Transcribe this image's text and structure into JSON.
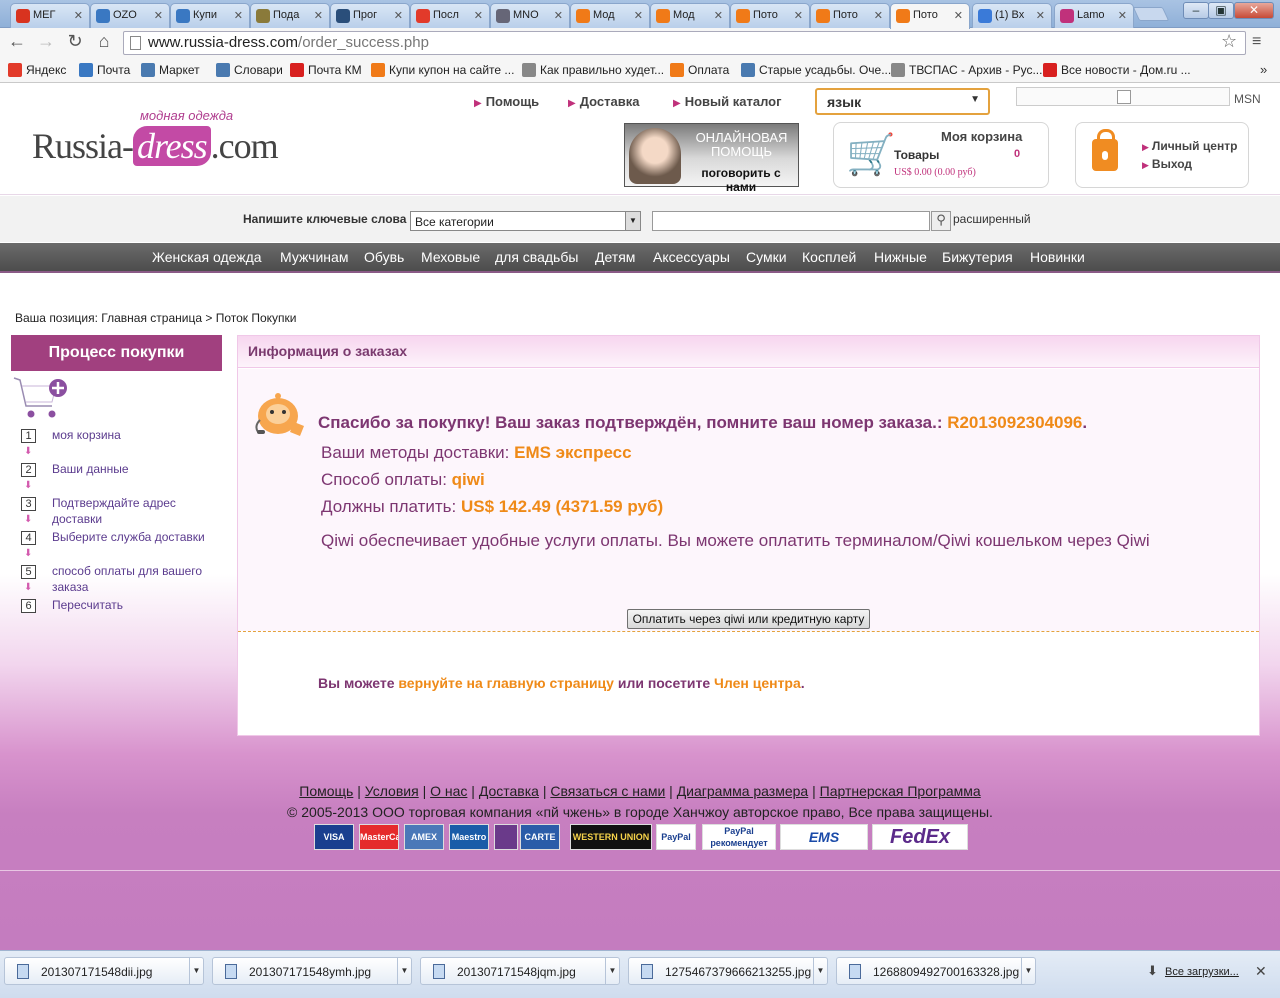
{
  "browser": {
    "tabs": [
      {
        "label": "МЕГ",
        "color": "#d8331f"
      },
      {
        "label": "OZO",
        "color": "#3a78c2"
      },
      {
        "label": "Купи",
        "color": "#3a78c2"
      },
      {
        "label": "Пода",
        "color": "#8a7a3a"
      },
      {
        "label": "Прог",
        "color": "#2a4e7a"
      },
      {
        "label": "Посл",
        "color": "#e23a2a"
      },
      {
        "label": "MNO",
        "color": "#667"
      },
      {
        "label": "Мод",
        "color": "#f07a18"
      },
      {
        "label": "Мод",
        "color": "#f07a18"
      },
      {
        "label": "Пото",
        "color": "#f07a18"
      },
      {
        "label": "Пото",
        "color": "#f07a18"
      },
      {
        "label": "Пото",
        "color": "#f07a18"
      },
      {
        "label": "(1) Вх",
        "color": "#3a7ad8"
      },
      {
        "label": "Lamo",
        "color": "#c0317b"
      }
    ],
    "active_tab": 11,
    "url_host": "www.russia-dress.com",
    "url_path": "/order_success.php",
    "bookmarks": [
      {
        "label": "Яндекс",
        "color": "#e23a2a"
      },
      {
        "label": "Почта",
        "color": "#3a78c2"
      },
      {
        "label": "Маркет",
        "color": "#4a7ab0"
      },
      {
        "label": "Словари",
        "color": "#4a7ab0"
      },
      {
        "label": "Почта КМ",
        "color": "#d8201f"
      },
      {
        "label": "Купи купон на сайте ...",
        "color": "#f07a18"
      },
      {
        "label": "Как правильно худет...",
        "color": "#888"
      },
      {
        "label": "Оплата",
        "color": "#f07a18"
      },
      {
        "label": "Старые усадьбы. Оче...",
        "color": "#4a7ab0"
      },
      {
        "label": "ТВСПАС - Архив - Рус...",
        "color": "#888"
      },
      {
        "label": "Все новости - Дом.ru ...",
        "color": "#d8201f"
      }
    ]
  },
  "header": {
    "logo_tag": "модная одежда",
    "logo_left": "Russia-",
    "logo_dress": "dress",
    "logo_right": ".com",
    "top_links": [
      "Помощь",
      "Доставка",
      "Новый каталог"
    ],
    "language_label": "язык",
    "msn_label": "MSN",
    "help_banner_line1": "ОНЛАЙНОВАЯ ПОМОЩЬ",
    "help_banner_line2": "поговорить с нами",
    "cart_title": "Моя корзина",
    "cart_goods_label": "Товары",
    "cart_goods_count": "0",
    "cart_sum": "US$ 0.00 (0.00 руб)",
    "account_links": [
      "Личный центр",
      "Выход"
    ]
  },
  "search": {
    "label": "Напишите ключевые слова",
    "category_value": "Все категории",
    "advanced_label": "расширенный"
  },
  "mainnav": [
    "Женская одежда",
    "Мужчинам",
    "Обувь",
    "Меховые",
    "для свадьбы",
    "Детям",
    "Аксессуары",
    "Сумки",
    "Косплей",
    "Нижные",
    "Бижутерия",
    "Новинки"
  ],
  "breadcrumb": "Ваша позиция: Главная страница > Поток Покупки",
  "sidebar": {
    "title": "Процесс покупки",
    "steps": [
      {
        "num": "1",
        "label": "моя корзина"
      },
      {
        "num": "2",
        "label": "Ваши данные"
      },
      {
        "num": "3",
        "label": "Подтверждайте адрес доставки"
      },
      {
        "num": "4",
        "label": "Выберите служба доставки"
      },
      {
        "num": "5",
        "label": "способ оплаты для вашего заказа"
      },
      {
        "num": "6",
        "label": "Пересчитать"
      }
    ]
  },
  "order": {
    "panel_title": "Информация о заказах",
    "thanks_text": "Спасибо за покупку! Ваш заказ подтверждён, помните ваш номер заказа.: ",
    "order_number": "R2013092304096",
    "thanks_end": ".",
    "delivery_label": "Ваши методы доставки: ",
    "delivery_value": "EMS экспресс",
    "payment_label": "Способ оплаты: ",
    "payment_value": "qiwi",
    "amount_label": "Должны платить: ",
    "amount_value": "US$ 142.49 (4371.59 руб)",
    "qiwi_note": "Qiwi обеспечивает удобные услуги оплаты. Вы можете оплатить терминалом/Qiwi кошельком через Qiwi",
    "pay_button": "Оплатить через qiwi или кредитную карту",
    "more_prefix": "Вы можете ",
    "more_link_home": "вернуйте на главную страницу",
    "more_middle": " или посетите ",
    "more_link_member": "Член центра",
    "more_suffix": "."
  },
  "footer": {
    "links": [
      "Помощь",
      "Условия",
      "О нас",
      "Доставка",
      "Связаться с нами",
      "Диаграмма размера",
      "Партнерская Программа"
    ],
    "copyright": "© 2005-2013 ООО торговая компания «пй чжень» в городе Ханчжоу авторское право, Все права защищены.",
    "payment_logos": [
      "VISA",
      "MasterCard",
      "AMEX",
      "Maestro",
      "",
      "CARTE BLEUE",
      "WESTERN UNION",
      "PayPal",
      "PayPal рекомендует",
      "EMS",
      "FedEx"
    ]
  },
  "downloads": {
    "files": [
      "201307171548dii.jpg",
      "201307171548ymh.jpg",
      "201307171548jqm.jpg",
      "1275467379666213255.jpg",
      "1268809492700163328.jpg"
    ],
    "all_label": "Все загрузки..."
  }
}
